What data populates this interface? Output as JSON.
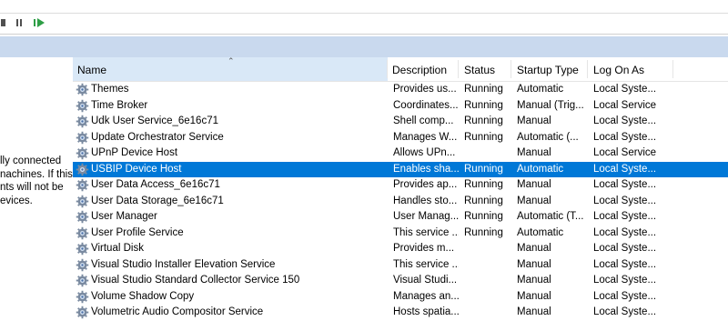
{
  "columns": [
    "Name",
    "Description",
    "Status",
    "Startup Type",
    "Log On As"
  ],
  "description_pane": "lly connected\nnachines. If this\nnts will not be\nevices.",
  "rows": [
    {
      "name": "Themes",
      "description": "Provides us...",
      "status": "Running",
      "startup": "Automatic",
      "logon": "Local Syste...",
      "selected": false
    },
    {
      "name": "Time Broker",
      "description": "Coordinates...",
      "status": "Running",
      "startup": "Manual (Trig...",
      "logon": "Local Service",
      "selected": false
    },
    {
      "name": "Udk User Service_6e16c71",
      "description": "Shell comp...",
      "status": "Running",
      "startup": "Manual",
      "logon": "Local Syste...",
      "selected": false
    },
    {
      "name": "Update Orchestrator Service",
      "description": "Manages W...",
      "status": "Running",
      "startup": "Automatic (...",
      "logon": "Local Syste...",
      "selected": false
    },
    {
      "name": "UPnP Device Host",
      "description": "Allows UPn...",
      "status": "",
      "startup": "Manual",
      "logon": "Local Service",
      "selected": false
    },
    {
      "name": "USBIP Device Host",
      "description": "Enables sha...",
      "status": "Running",
      "startup": "Automatic",
      "logon": "Local Syste...",
      "selected": true
    },
    {
      "name": "User Data Access_6e16c71",
      "description": "Provides ap...",
      "status": "Running",
      "startup": "Manual",
      "logon": "Local Syste...",
      "selected": false
    },
    {
      "name": "User Data Storage_6e16c71",
      "description": "Handles sto...",
      "status": "Running",
      "startup": "Manual",
      "logon": "Local Syste...",
      "selected": false
    },
    {
      "name": "User Manager",
      "description": "User Manag...",
      "status": "Running",
      "startup": "Automatic (T...",
      "logon": "Local Syste...",
      "selected": false
    },
    {
      "name": "User Profile Service",
      "description": "This service ...",
      "status": "Running",
      "startup": "Automatic",
      "logon": "Local Syste...",
      "selected": false
    },
    {
      "name": "Virtual Disk",
      "description": "Provides m...",
      "status": "",
      "startup": "Manual",
      "logon": "Local Syste...",
      "selected": false
    },
    {
      "name": "Visual Studio Installer Elevation Service",
      "description": "This service ...",
      "status": "",
      "startup": "Manual",
      "logon": "Local Syste...",
      "selected": false
    },
    {
      "name": "Visual Studio Standard Collector Service 150",
      "description": "Visual Studi...",
      "status": "",
      "startup": "Manual",
      "logon": "Local Syste...",
      "selected": false
    },
    {
      "name": "Volume Shadow Copy",
      "description": "Manages an...",
      "status": "",
      "startup": "Manual",
      "logon": "Local Syste...",
      "selected": false
    },
    {
      "name": "Volumetric Audio Compositor Service",
      "description": "Hosts spatia...",
      "status": "",
      "startup": "Manual",
      "logon": "Local Syste...",
      "selected": false
    }
  ],
  "colors": {
    "selection": "#0078d7",
    "header_band": "#c9d9ee",
    "sorted_header": "#d9e8f7",
    "restart_icon": "#2e9e46"
  },
  "icons": {
    "toolbar": [
      "stop-icon",
      "pause-icon",
      "restart-icon"
    ],
    "row": "service-gear-icon",
    "sort": "sort-ascending-icon"
  }
}
